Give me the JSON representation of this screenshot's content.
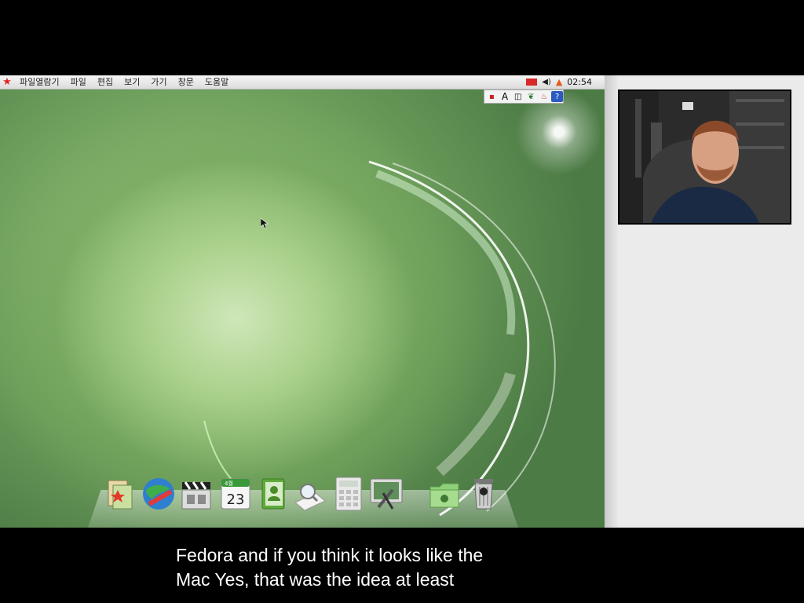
{
  "menubar": {
    "logo": "star-icon",
    "items": [
      "파일열람기",
      "파일",
      "편집",
      "보기",
      "가기",
      "창문",
      "도움말"
    ],
    "clock": "02:54"
  },
  "ime_bar": {
    "input_mode": "A"
  },
  "dock": {
    "calendar_month": "4월",
    "calendar_day": "23"
  },
  "caption": {
    "line1": "Fedora and if you think it looks like the",
    "line2": "Mac Yes, that was the idea at least"
  },
  "colors": {
    "menubar_star": "#e32222",
    "tray_flag": "#d82828",
    "desktop_green": "#6e9f5c",
    "caption_text": "#ffffff"
  }
}
